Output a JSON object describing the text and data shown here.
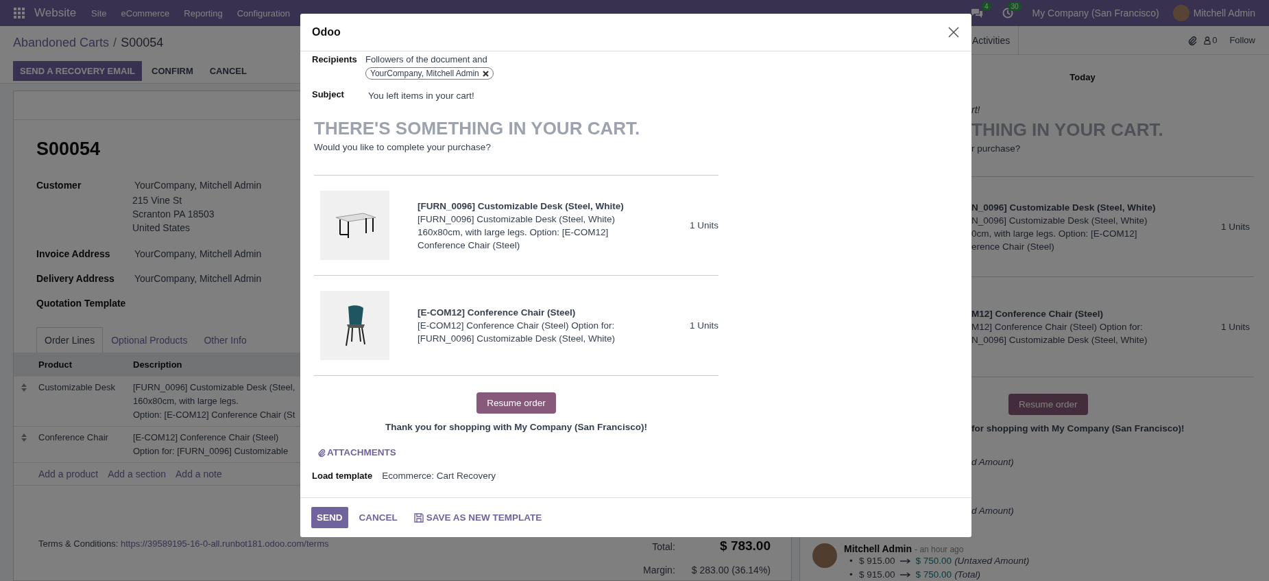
{
  "navbar": {
    "app": "Website",
    "menu": [
      "Site",
      "eCommerce",
      "Reporting",
      "Configuration"
    ],
    "messages_badge": "4",
    "activities_badge": "30",
    "company": "My Company (San Francisco)",
    "user": "Mitchell Admin"
  },
  "control_panel": {
    "breadcrumb_parent": "Abandoned Carts",
    "separator": "/",
    "breadcrumb_current": "S00054",
    "actions": [
      {
        "label": "SEND A RECOVERY EMAIL",
        "primary": true
      },
      {
        "label": "CONFIRM",
        "primary": false
      },
      {
        "label": "CANCEL",
        "primary": false
      }
    ]
  },
  "form": {
    "name": "S00054",
    "fields": [
      {
        "label": "Customer",
        "value": "YourCompany, Mitchell Admin",
        "address": [
          "215 Vine St",
          "Scranton PA 18503",
          "United States"
        ]
      },
      {
        "label": "Invoice Address",
        "value": "YourCompany, Mitchell Admin"
      },
      {
        "label": "Delivery Address",
        "value": "YourCompany, Mitchell Admin"
      },
      {
        "label": "Quotation Template"
      }
    ],
    "tabs": [
      {
        "label": "Order Lines",
        "selected": true
      },
      {
        "label": "Optional Products",
        "selected": false
      },
      {
        "label": "Other Info",
        "selected": false
      }
    ],
    "columns": [
      "Product",
      "Description"
    ],
    "lines": [
      {
        "product": "Customizable Desk",
        "description": [
          "[FURN_0096] Customizable Desk (Steel,",
          "160x80cm, with large legs.",
          "Option: [E-COM12] Conference Chair (St"
        ]
      },
      {
        "product": "Conference Chair",
        "description": [
          "[E-COM12] Conference Chair (Steel)",
          "Option for: [FURN_0096] Customizable"
        ]
      }
    ],
    "add_links": [
      "Add a product",
      "Add a section",
      "Add a note"
    ],
    "terms_label": "Terms & Conditions:",
    "terms_link": "https://39589195-16-0-all.runbot181.odoo.com/terms",
    "totals": [
      {
        "label": "Total:",
        "value": "$ 783.00",
        "kind": "grand"
      },
      {
        "label": "Margin:",
        "value": "$ 283.00 (36.14%)",
        "kind": "plain"
      }
    ]
  },
  "chatter": {
    "activities": "Activities",
    "followers_count": "0",
    "follow": "Follow",
    "date": "Today",
    "email_fragment": {
      "subject": "rt!",
      "heading": "THING IN YOUR CART.",
      "question": "r purchase?",
      "products": [
        {
          "title": "N_0096] Customizable Desk (Steel, White)",
          "lines": [
            "N_0096] Customizable Desk (Steel, White)",
            "0cm, with large legs. Option: [E-COM12]",
            "erence Chair (Steel)"
          ],
          "quantity": "1 Units"
        },
        {
          "title": "M12] Conference Chair (Steel)",
          "lines": [
            "M12] Conference Chair (Steel) Option for:",
            "N_0096] Customizable Desk (Steel, White)"
          ],
          "quantity": "1 Units"
        }
      ],
      "button": "Resume order",
      "thanks": "for shopping with My Company (San Francisco)!",
      "notes": [
        "d Amount)",
        "d Amount)"
      ]
    },
    "message": {
      "author": "Mitchell Admin",
      "time": "- an hour ago",
      "marker": "•",
      "changes": [
        {
          "old": "$ 915.00",
          "new": "$ 750.00",
          "field": "(Untaxed Amount)"
        },
        {
          "old": "$ 915.00",
          "new": "$ 750.00",
          "field": "(Total)"
        }
      ]
    }
  },
  "dialog": {
    "title": "Odoo",
    "recipients_label": "Recipients",
    "recipients_text": "Followers of the document and",
    "recipient_tags": [
      "YourCompany, Mitchell Admin"
    ],
    "subject_label": "Subject",
    "subject": "You left items in your cart!",
    "email": {
      "heading": "THERE'S SOMETHING IN YOUR CART.",
      "question": "Would you like to complete your purchase?",
      "products": [
        {
          "title": "[FURN_0096] Customizable Desk (Steel, White)",
          "lines": [
            "[FURN_0096] Customizable Desk (Steel, White)",
            "160x80cm, with large legs. Option: [E-COM12]",
            "Conference Chair (Steel)"
          ],
          "quantity": "1 Units"
        },
        {
          "title": "[E-COM12] Conference Chair (Steel)",
          "lines": [
            "[E-COM12] Conference Chair (Steel) Option for:",
            "[FURN_0096] Customizable Desk (Steel, White)"
          ],
          "quantity": "1 Units"
        }
      ],
      "button": "Resume order",
      "thanks": "Thank you for shopping with My Company (San Francisco)!"
    },
    "attachments": "ATTACHMENTS",
    "template_label": "Load template",
    "template": "Ecommerce: Cart Recovery",
    "buttons": [
      {
        "label": "SEND",
        "primary": true,
        "icon": false
      },
      {
        "label": "CANCEL",
        "primary": false,
        "icon": false
      },
      {
        "label": "SAVE AS NEW TEMPLATE",
        "primary": false,
        "icon": true
      }
    ]
  }
}
